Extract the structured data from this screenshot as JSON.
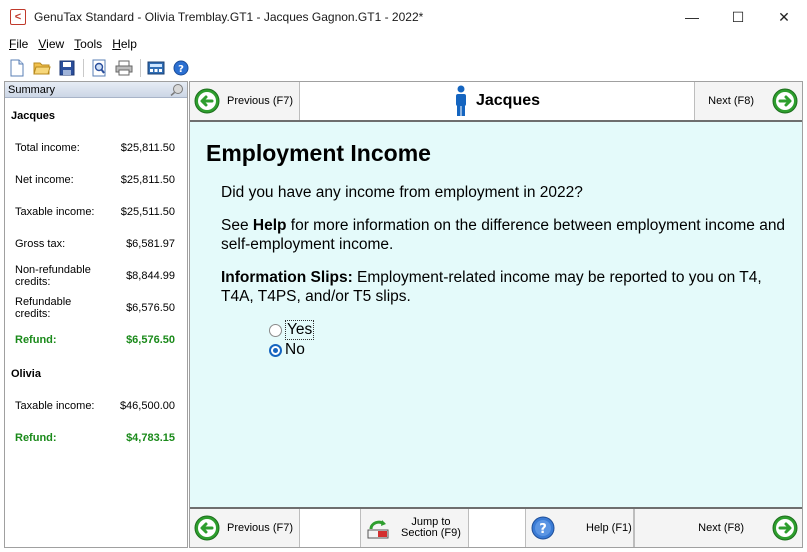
{
  "window": {
    "title": "GenuTax Standard - Olivia Tremblay.GT1 - Jacques Gagnon.GT1 - 2022*",
    "icon_glyph": "<",
    "min_glyph": "—",
    "max_glyph": "☐",
    "close_glyph": "✕"
  },
  "menu": {
    "file": {
      "u": "F",
      "rest": "ile"
    },
    "view": {
      "u": "V",
      "rest": "iew"
    },
    "tools": {
      "u": "T",
      "rest": "ools"
    },
    "help": {
      "u": "H",
      "rest": "elp"
    }
  },
  "toolbar": {
    "icons": [
      "new-document-icon",
      "open-folder-icon",
      "save-disk-icon",
      "print-preview-icon",
      "print-icon",
      "calculator-icon",
      "help-icon"
    ]
  },
  "sidebar": {
    "header": "Summary",
    "people": [
      {
        "name": "Jacques",
        "rows": [
          {
            "label": "Total income:",
            "value": "$25,811.50"
          },
          {
            "label": "Net income:",
            "value": "$25,811.50"
          },
          {
            "label": "Taxable income:",
            "value": "$25,511.50"
          },
          {
            "label": "Gross tax:",
            "value": "$6,581.97"
          },
          {
            "label_line1": "Non-refundable",
            "label_line2": "credits:",
            "value": "$8,844.99"
          },
          {
            "label_line1": "Refundable",
            "label_line2": "credits:",
            "value": "$6,576.50"
          },
          {
            "label": "Refund:",
            "value": "$6,576.50"
          }
        ]
      },
      {
        "name": "Olivia",
        "rows": [
          {
            "label": "Taxable income:",
            "value": "$46,500.00"
          },
          {
            "label": "Refund:",
            "value": "$4,783.15"
          }
        ]
      }
    ]
  },
  "nav": {
    "previous": "Previous (F7)",
    "next": "Next (F8)",
    "person": "Jacques"
  },
  "content": {
    "title": "Employment Income",
    "question": "Did you have any income from employment in 2022?",
    "help_pre": "See ",
    "help_bold": "Help",
    "help_post": " for more information on the difference between employment income and self-employment income.",
    "slips_bold": "Information Slips:",
    "slips_text": " Employment-related income may be reported to you on T4, T4A, T4PS, and/or T5 slips.",
    "options": [
      {
        "label": "Yes",
        "selected": false
      },
      {
        "label": "No",
        "selected": true
      }
    ]
  },
  "footer": {
    "previous": "Previous (F7)",
    "jump_line1": "Jump to",
    "jump_line2": "Section (F9)",
    "help": "Help (F1)",
    "next": "Next (F8)"
  },
  "colors": {
    "content_bg": "#e4fafa",
    "refund_green": "#1a8a1a",
    "nav_green": "#2e9e2e",
    "person_blue": "#1565c0"
  }
}
